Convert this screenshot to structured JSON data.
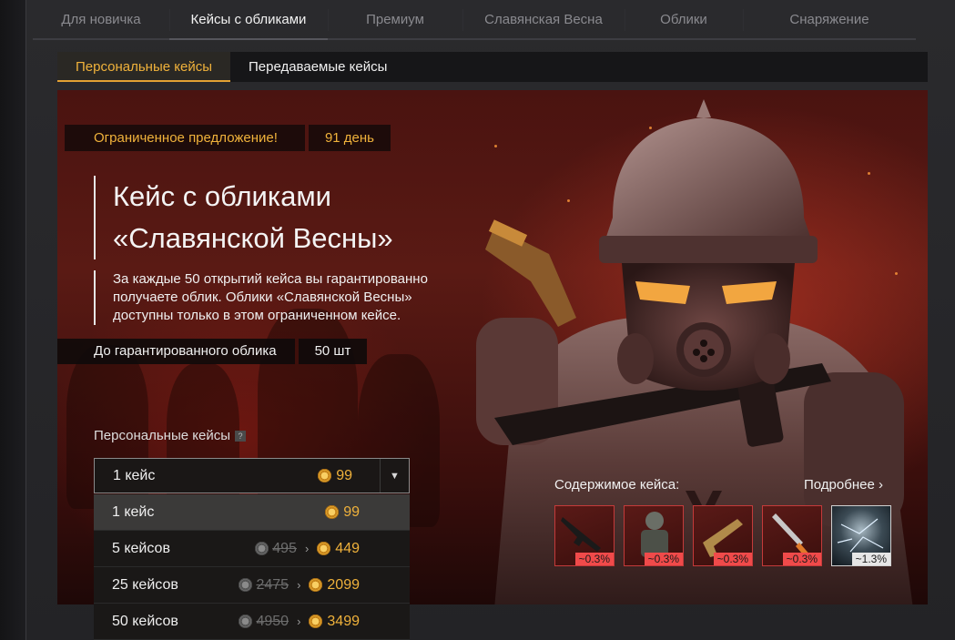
{
  "top_tabs": [
    {
      "label": "Для новичка",
      "active": false
    },
    {
      "label": "Кейсы с обликами",
      "active": true
    },
    {
      "label": "Премиум",
      "active": false
    },
    {
      "label": "Славянская Весна",
      "active": false
    },
    {
      "label": "Облики",
      "active": false
    },
    {
      "label": "Снаряжение",
      "active": false
    }
  ],
  "sub_tabs": [
    {
      "label": "Персональные кейсы",
      "active": true
    },
    {
      "label": "Передаваемые кейсы",
      "active": false
    }
  ],
  "promo": {
    "label": "Ограниченное предложение!",
    "days": "91 день"
  },
  "title": {
    "line1": "Кейс с обликами",
    "line2": "«Славянской Весны»"
  },
  "description": {
    "line1": "За каждые 50 открытий кейса вы гарантированно",
    "line2": "получаете облик. Облики «Славянской Весны»",
    "line3": "доступны только в этом ограниченном кейсе."
  },
  "guarantee": {
    "label": "До гарантированного облика",
    "count": "50 шт"
  },
  "personal_label": "Персональные кейсы",
  "help_icon": "?",
  "dropdown": {
    "selected_label": "1 кейс",
    "selected_price": "99",
    "arrow": "▼"
  },
  "options": [
    {
      "label": "1 кейс",
      "old_price": "",
      "price": "99"
    },
    {
      "label": "5 кейсов",
      "old_price": "495",
      "price": "449"
    },
    {
      "label": "25 кейсов",
      "old_price": "2475",
      "price": "2099"
    },
    {
      "label": "50 кейсов",
      "old_price": "4950",
      "price": "3499"
    }
  ],
  "contents_label": "Содержимое кейса:",
  "more_link": "Подробнее ›",
  "items": [
    {
      "icon": "rifle-icon",
      "chance": "~0.3%"
    },
    {
      "icon": "armor-icon",
      "chance": "~0.3%"
    },
    {
      "icon": "pistol-icon",
      "chance": "~0.3%"
    },
    {
      "icon": "knife-icon",
      "chance": "~0.3%"
    },
    {
      "icon": "crystal-icon",
      "chance": "~1.3%"
    }
  ],
  "colors": {
    "accent": "#f0b23b",
    "rare": "#f04a4a",
    "bg": "#1b1b1d"
  }
}
